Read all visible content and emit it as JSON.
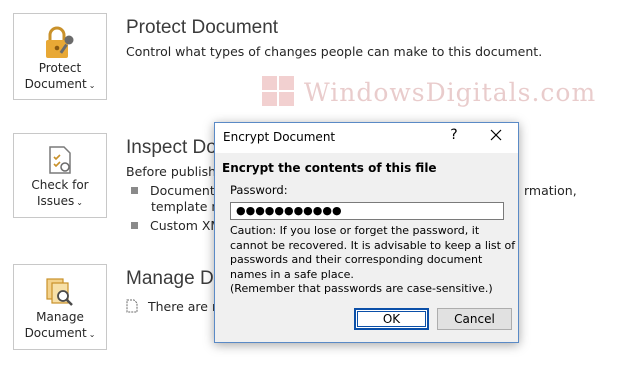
{
  "protect": {
    "button_line1": "Protect",
    "button_line2": "Document",
    "title": "Protect Document",
    "description": "Control what types of changes people can make to this document."
  },
  "inspect": {
    "button_line1": "Check for",
    "button_line2": "Issues",
    "title": "Inspect Do",
    "description": "Before publishing",
    "bullets": [
      "Document p",
      "template na",
      "Custom XM"
    ],
    "bullet_right_text": "rmation,"
  },
  "manage": {
    "button_line1": "Manage",
    "button_line2": "Document",
    "title": "Manage Do",
    "status_text": "There are no"
  },
  "watermark": {
    "text": "WindowsDigitals.com"
  },
  "dialog": {
    "title": "Encrypt Document",
    "help": "?",
    "heading": "Encrypt the contents of this file",
    "password_label": "Password:",
    "password_value": "●●●●●●●●●●●",
    "caution_lines": [
      "Caution: If you lose or forget the password, it",
      "cannot be recovered. It is advisable to keep a list of",
      "passwords and their corresponding document",
      "names in a safe place.",
      "(Remember that passwords are case-sensitive.)"
    ],
    "ok_label": "OK",
    "cancel_label": "Cancel"
  },
  "colors": {
    "dialog_border": "#5a8ac6",
    "ok_border": "#0b4fa8",
    "lock_gold": "#e8a835"
  }
}
